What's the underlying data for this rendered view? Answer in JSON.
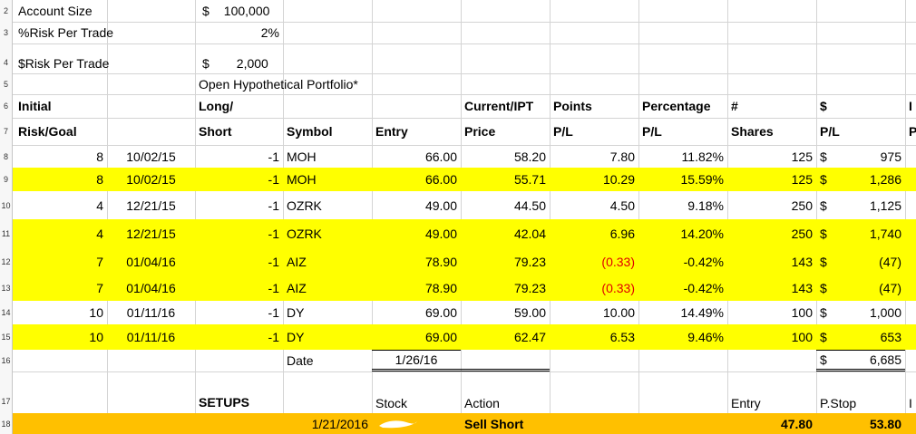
{
  "header": {
    "account_size_label": "Account Size",
    "account_size_currency": "$",
    "account_size_value": "100,000",
    "risk_pct_label": "%Risk Per Trade",
    "risk_pct_value": "2%",
    "risk_dollar_label": "$Risk Per Trade",
    "risk_dollar_currency": "$",
    "risk_dollar_value": "2,000",
    "portfolio_title": "Open Hypothetical Portfolio*"
  },
  "row_numbers": [
    "2",
    "3",
    "4",
    "5",
    "6",
    "7",
    "8",
    "9",
    "10",
    "11",
    "12",
    "13",
    "14",
    "15",
    "16",
    "17",
    "18"
  ],
  "columns_row1": {
    "initial": "Initial",
    "long": "Long/",
    "current": "Current/IPT",
    "points": "Points",
    "percentage": "Percentage",
    "shares_hash": "#",
    "dollar": "$",
    "i": "I"
  },
  "columns_row2": {
    "risk_goal": "Risk/Goal",
    "short": "Short",
    "symbol": "Symbol",
    "entry": "Entry",
    "price": "Price",
    "points_pl": "P/L",
    "pct_pl": "P/L",
    "shares": "Shares",
    "dollar_pl": "P/L",
    "p": "P"
  },
  "trades": [
    {
      "risk": "8",
      "date": "10/02/15",
      "ls": "-1",
      "symbol": "MOH",
      "entry": "66.00",
      "price": "58.20",
      "points": "7.80",
      "pct": "11.82%",
      "shares": "125",
      "cur": "$",
      "pl": "975",
      "highlight": false,
      "neg": false
    },
    {
      "risk": "8",
      "date": "10/02/15",
      "ls": "-1",
      "symbol": "MOH",
      "entry": "66.00",
      "price": "55.71",
      "points": "10.29",
      "pct": "15.59%",
      "shares": "125",
      "cur": "$",
      "pl": "1,286",
      "highlight": true,
      "neg": false
    },
    {
      "risk": "4",
      "date": "12/21/15",
      "ls": "-1",
      "symbol": "OZRK",
      "entry": "49.00",
      "price": "44.50",
      "points": "4.50",
      "pct": "9.18%",
      "shares": "250",
      "cur": "$",
      "pl": "1,125",
      "highlight": false,
      "neg": false
    },
    {
      "risk": "4",
      "date": "12/21/15",
      "ls": "-1",
      "symbol": "OZRK",
      "entry": "49.00",
      "price": "42.04",
      "points": "6.96",
      "pct": "14.20%",
      "shares": "250",
      "cur": "$",
      "pl": "1,740",
      "highlight": true,
      "neg": false
    },
    {
      "risk": "7",
      "date": "01/04/16",
      "ls": "-1",
      "symbol": "AIZ",
      "entry": "78.90",
      "price": "79.23",
      "points": "(0.33)",
      "pct": "-0.42%",
      "shares": "143",
      "cur": "$",
      "pl": "(47)",
      "highlight": true,
      "neg": true
    },
    {
      "risk": "7",
      "date": "01/04/16",
      "ls": "-1",
      "symbol": "AIZ",
      "entry": "78.90",
      "price": "79.23",
      "points": "(0.33)",
      "pct": "-0.42%",
      "shares": "143",
      "cur": "$",
      "pl": "(47)",
      "highlight": true,
      "neg": true
    },
    {
      "risk": "10",
      "date": "01/11/16",
      "ls": "-1",
      "symbol": "DY",
      "entry": "69.00",
      "price": "59.00",
      "points": "10.00",
      "pct": "14.49%",
      "shares": "100",
      "cur": "$",
      "pl": "1,000",
      "highlight": false,
      "neg": false
    },
    {
      "risk": "10",
      "date": "01/11/16",
      "ls": "-1",
      "symbol": "DY",
      "entry": "69.00",
      "price": "62.47",
      "points": "6.53",
      "pct": "9.46%",
      "shares": "100",
      "cur": "$",
      "pl": "653",
      "highlight": true,
      "neg": false
    }
  ],
  "summary": {
    "date_label": "Date",
    "date_value": "1/26/16",
    "total_currency": "$",
    "total_value": "6,685"
  },
  "setups_header": {
    "setups": "SETUPS",
    "stock": "Stock",
    "action": "Action",
    "entry": "Entry",
    "pstop": "P.Stop",
    "i": "I"
  },
  "setups_row": {
    "date": "1/21/2016",
    "action": "Sell Short",
    "entry": "47.80",
    "pstop": "53.80"
  },
  "colors": {
    "yellow": "#ffff00",
    "orange": "#ffc000",
    "negative": "#e00000"
  }
}
